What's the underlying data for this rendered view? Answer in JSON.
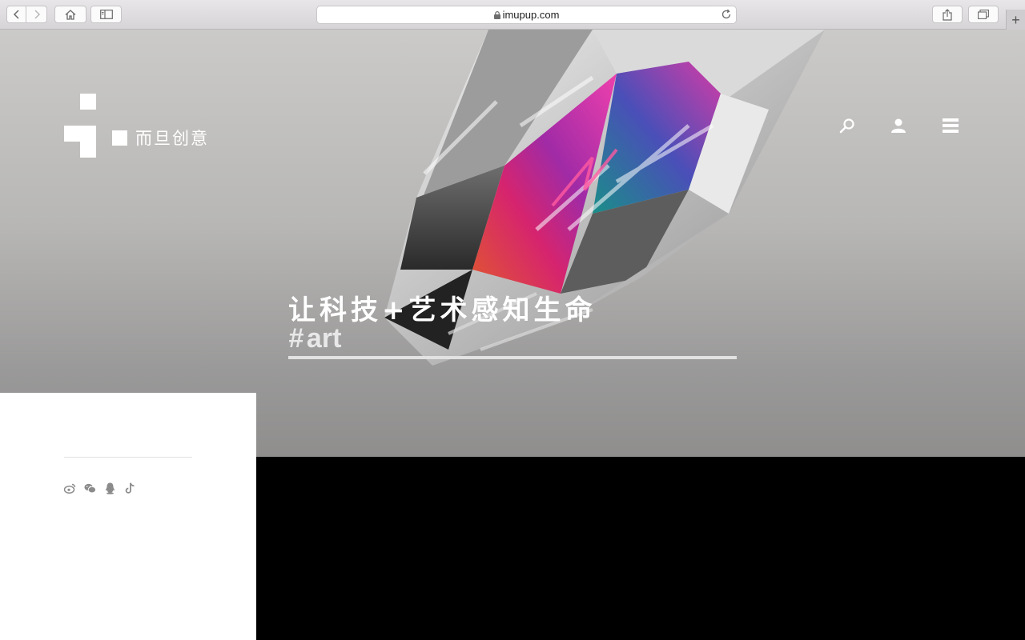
{
  "browser": {
    "url": "imupup.com",
    "new_tab_label": "+"
  },
  "site": {
    "logo_text": "而旦创意",
    "tagline": "让科技+艺术感知生命",
    "hashtag_symbol": "#",
    "hashtag_word": "art"
  },
  "colors": {
    "accent_white": "#ffffff",
    "hero_gray": "#b8b7b5",
    "footer_black": "#000000"
  },
  "icons": {
    "nav": [
      "search-icon",
      "user-icon",
      "menu-icon"
    ],
    "social": [
      "weibo-icon",
      "wechat-icon",
      "qq-icon",
      "tiktok-icon"
    ]
  }
}
